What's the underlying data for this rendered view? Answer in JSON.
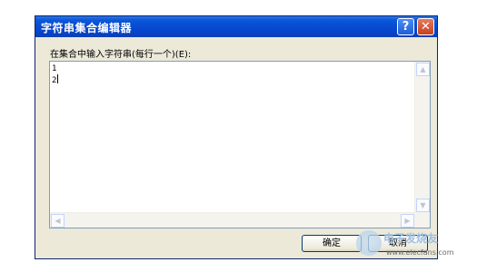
{
  "dialog": {
    "title": "字符串集合编辑器",
    "help_glyph": "?",
    "close_glyph": "✕"
  },
  "editor": {
    "prompt": "在集合中输入字符串(每行一个)(E):",
    "lines": [
      "1",
      "2"
    ]
  },
  "scrollbars": {
    "up_glyph": "▲",
    "down_glyph": "▼",
    "left_glyph": "◀",
    "right_glyph": "▶"
  },
  "buttons": {
    "ok": "确定",
    "cancel": "取消"
  },
  "watermark": {
    "name": "电子发烧友",
    "url": "www.elecfans.com"
  },
  "colors": {
    "titlebar": "#0648cf",
    "dialog_bg": "#ece9d8",
    "close_button": "#c7401f",
    "help_button": "#1d5fd6"
  }
}
